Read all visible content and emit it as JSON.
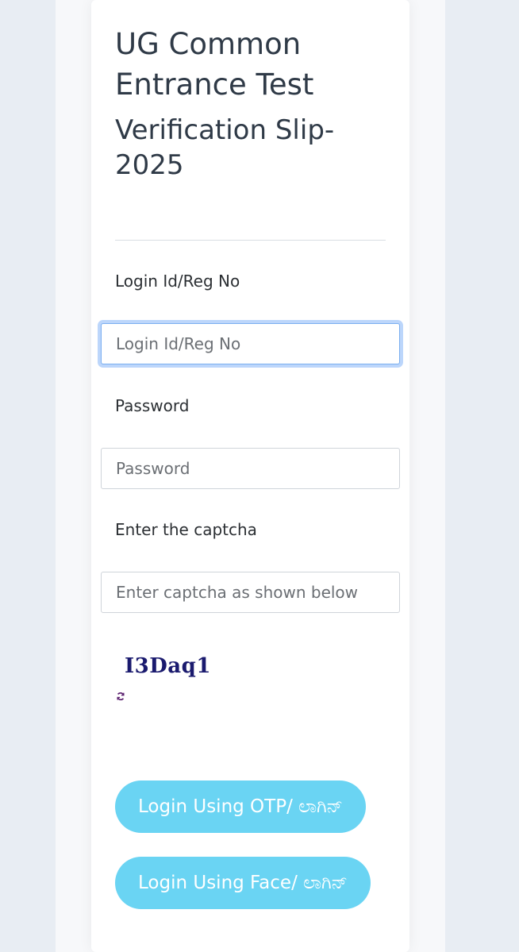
{
  "header": {
    "title": "UG Common Entrance Test",
    "subtitle": "Verification Slip-2025"
  },
  "form": {
    "login_label": "Login Id/Reg No",
    "login_placeholder": "Login Id/Reg No",
    "login_value": "",
    "password_label": "Password",
    "password_placeholder": "Password",
    "password_value": "",
    "captcha_label": "Enter the captcha",
    "captcha_placeholder": "Enter captcha as shown below",
    "captcha_value": "",
    "captcha_text": "I3Daq1",
    "refresh_icon": "refresh-icon"
  },
  "buttons": {
    "otp_login": "Login Using OTP/ ಲಾಗಿನ್",
    "face_login": "Login Using Face/ ಲಾಗಿನ್"
  },
  "colors": {
    "button_bg": "#6ad4f3",
    "focus_ring": "#bcd6fb",
    "captcha_text": "#1a1a6e",
    "title_text": "#2f3a47"
  }
}
